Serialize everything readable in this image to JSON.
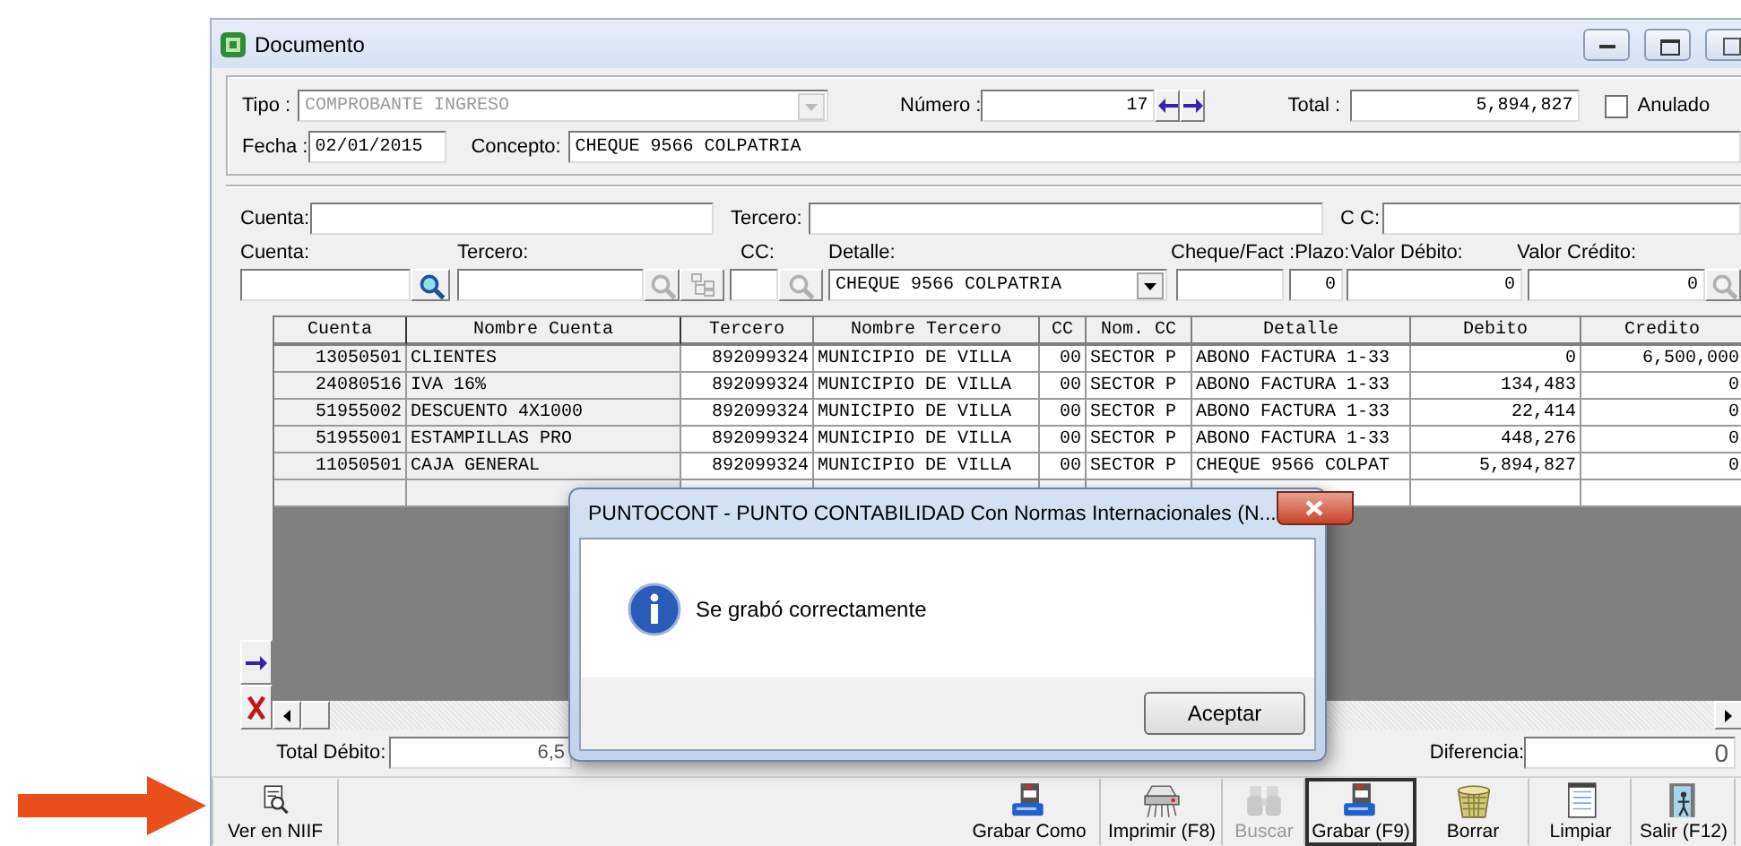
{
  "window": {
    "title": "Documento"
  },
  "header": {
    "tipo": {
      "label": "Tipo :",
      "value": "COMPROBANTE INGRESO",
      "disabled": true
    },
    "numero": {
      "label": "Número :",
      "value": "17"
    },
    "total": {
      "label": "Total :",
      "value": "5,894,827"
    },
    "anulado": {
      "label": "Anulado",
      "checked": false
    },
    "fecha": {
      "label": "Fecha :",
      "value": "02/01/2015"
    },
    "concepto": {
      "label": "Concepto:",
      "value": "CHEQUE 9566 COLPATRIA"
    }
  },
  "filter": [
    {
      "label": "Cuenta:"
    },
    {
      "label": "Tercero:"
    },
    {
      "label": "C C:"
    }
  ],
  "entry": {
    "cuenta": {
      "label": "Cuenta:"
    },
    "tercero": {
      "label": "Tercero:"
    },
    "cc": {
      "label": "CC:"
    },
    "detalle": {
      "label": "Detalle:",
      "value": "CHEQUE 9566 COLPATRIA"
    },
    "cheque": {
      "label": "Cheque/Fact :"
    },
    "plazo": {
      "label": "Plazo:",
      "value": "0"
    },
    "valor_debito": {
      "label": "Valor Débito:",
      "value": "0"
    },
    "valor_credito": {
      "label": "Valor Crédito:",
      "value": "0"
    }
  },
  "table": {
    "columns": [
      {
        "label": "Cuenta",
        "kind": "number",
        "frozen": true
      },
      {
        "label": "Nombre Cuenta",
        "kind": "text",
        "frozen": true
      },
      {
        "label": "Tercero",
        "kind": "number",
        "frozen": false
      },
      {
        "label": "Nombre Tercero",
        "kind": "text",
        "frozen": false
      },
      {
        "label": "CC",
        "kind": "number",
        "frozen": false
      },
      {
        "label": "Nom. CC",
        "kind": "text",
        "frozen": false
      },
      {
        "label": "Detalle",
        "kind": "text",
        "frozen": false
      },
      {
        "label": "Debito",
        "kind": "number",
        "frozen": false
      },
      {
        "label": "Credito",
        "kind": "number",
        "frozen": false
      }
    ],
    "rows": [
      [
        "13050501",
        "CLIENTES",
        "892099324",
        "MUNICIPIO DE VILLA",
        "00",
        "SECTOR P",
        "ABONO FACTURA 1-33",
        "0",
        "6,500,000"
      ],
      [
        "24080516",
        "IVA 16%",
        "892099324",
        "MUNICIPIO DE VILLA",
        "00",
        "SECTOR P",
        "ABONO FACTURA 1-33",
        "134,483",
        "0"
      ],
      [
        "51955002",
        "DESCUENTO 4X1000",
        "892099324",
        "MUNICIPIO DE VILLA",
        "00",
        "SECTOR P",
        "ABONO FACTURA 1-33",
        "22,414",
        "0"
      ],
      [
        "51955001",
        "ESTAMPILLAS PRO",
        "892099324",
        "MUNICIPIO DE VILLA",
        "00",
        "SECTOR P",
        "ABONO FACTURA 1-33",
        "448,276",
        "0"
      ],
      [
        "11050501",
        "CAJA GENERAL",
        "892099324",
        "MUNICIPIO DE VILLA",
        "00",
        "SECTOR P",
        "CHEQUE 9566 COLPAT",
        "5,894,827",
        "0"
      ]
    ]
  },
  "totals": {
    "total_debito": {
      "label": "Total Débito:",
      "value": "6,5"
    },
    "diferencia": {
      "label": "Diferencia:",
      "value": "0"
    }
  },
  "toolbar": [
    {
      "label": "Ver en NIIF",
      "kind": "view",
      "disabled": false,
      "pressed": false
    },
    {
      "label": "Grabar Como",
      "kind": "save",
      "disabled": false,
      "pressed": false
    },
    {
      "label": "Imprimir (F8)",
      "kind": "print",
      "disabled": false,
      "pressed": false
    },
    {
      "label": "Buscar",
      "kind": "find",
      "disabled": true,
      "pressed": false
    },
    {
      "label": "Grabar (F9)",
      "kind": "save",
      "disabled": false,
      "pressed": true
    },
    {
      "label": "Borrar",
      "kind": "delete",
      "disabled": false,
      "pressed": false
    },
    {
      "label": "Limpiar",
      "kind": "clear",
      "disabled": false,
      "pressed": false
    },
    {
      "label": "Salir (F12)",
      "kind": "exit",
      "disabled": false,
      "pressed": false
    }
  ],
  "dialog": {
    "title": "PUNTOCONT - PUNTO CONTABILIDAD Con Normas Internacionales (N...",
    "message": "Se grabó correctamente",
    "button": "Aceptar"
  }
}
